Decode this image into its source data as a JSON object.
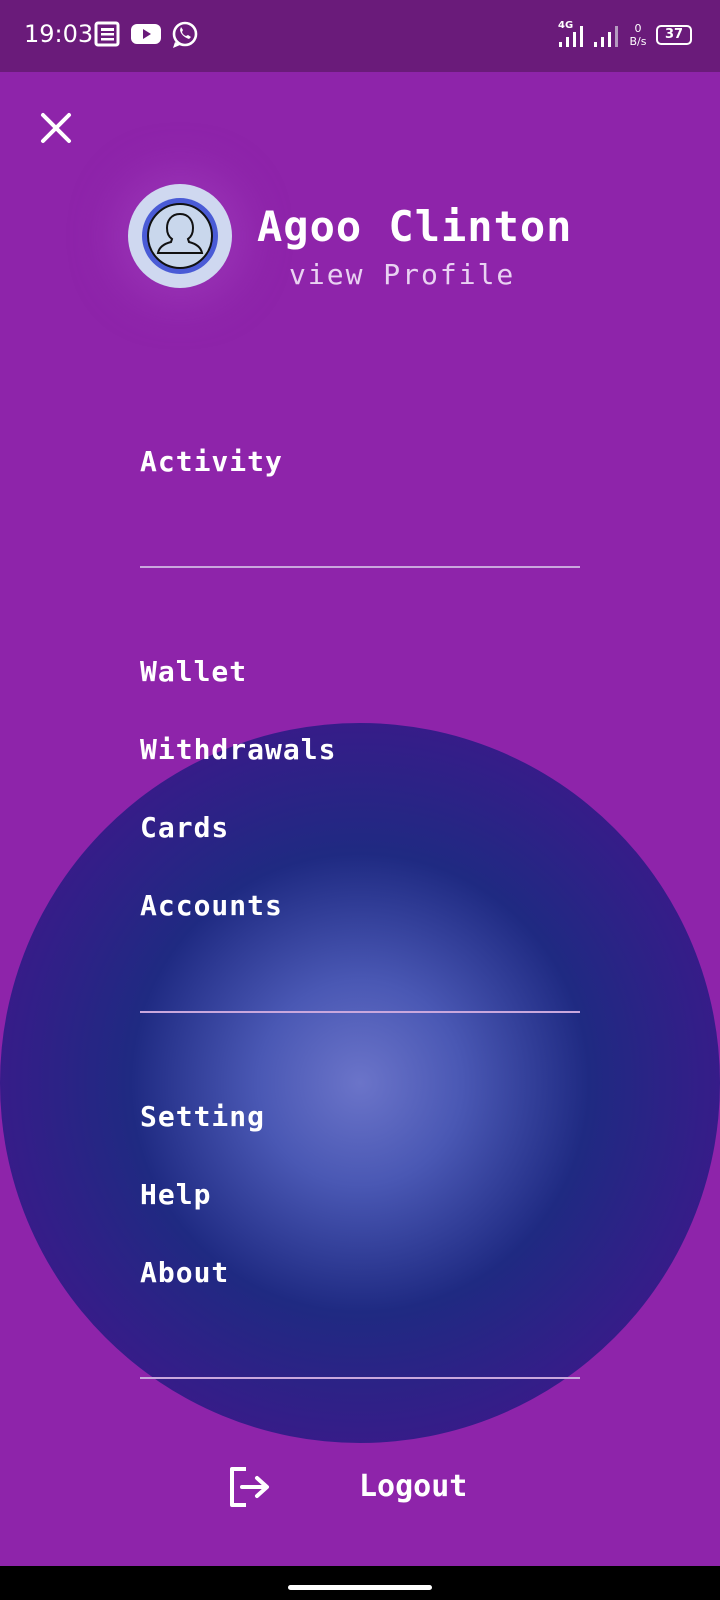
{
  "status_bar": {
    "time": "19:03",
    "network": "4G",
    "speed_value": "0",
    "speed_unit": "B/s",
    "battery": "37",
    "notification_icons": [
      "news-icon",
      "youtube-icon",
      "whatsapp-icon"
    ]
  },
  "colors": {
    "background": "#8e24aa",
    "status_bar": "#6a1b7a",
    "orb_center": "#6b74c9",
    "orb_edge": "#3a1a8a",
    "text": "#ffffff"
  },
  "drawer": {
    "close_icon": "close-icon",
    "profile": {
      "name": "Agoo Clinton",
      "link": "view Profile",
      "avatar_icon": "user-avatar-icon"
    },
    "sections": [
      {
        "items": [
          "Activity"
        ]
      },
      {
        "items": [
          "Wallet",
          "Withdrawals",
          "Cards",
          "Accounts"
        ]
      },
      {
        "items": [
          "Setting",
          "Help",
          "About"
        ]
      }
    ],
    "logout": {
      "label": "Logout",
      "icon": "logout-icon"
    }
  }
}
